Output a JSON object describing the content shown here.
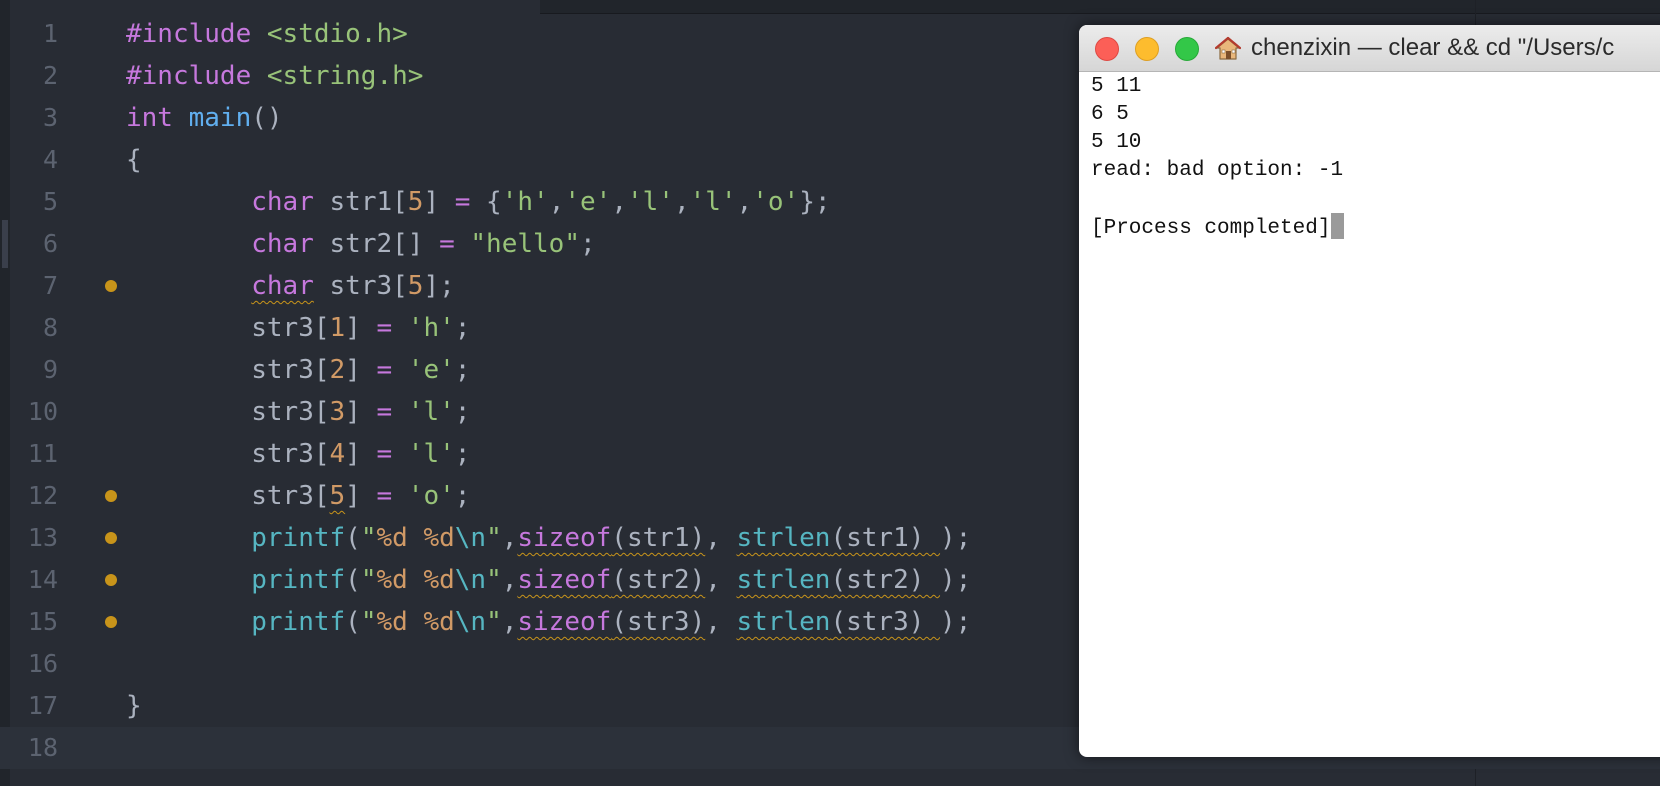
{
  "editor": {
    "lines": [
      {
        "n": "1",
        "dot": false,
        "cursor": false,
        "tokens": [
          {
            "t": "#include ",
            "c": "kw"
          },
          {
            "t": "<stdio.h>",
            "c": "str"
          }
        ]
      },
      {
        "n": "2",
        "dot": false,
        "cursor": false,
        "tokens": [
          {
            "t": "#include ",
            "c": "kw"
          },
          {
            "t": "<string.h>",
            "c": "str"
          }
        ]
      },
      {
        "n": "3",
        "dot": false,
        "cursor": false,
        "tokens": [
          {
            "t": "int ",
            "c": "kw"
          },
          {
            "t": "main",
            "c": "fn"
          },
          {
            "t": "()",
            "c": "punc"
          }
        ]
      },
      {
        "n": "4",
        "dot": false,
        "cursor": false,
        "tokens": [
          {
            "t": "{",
            "c": "punc"
          }
        ]
      },
      {
        "n": "5",
        "dot": false,
        "cursor": false,
        "tokens": [
          {
            "t": "        ",
            "c": "plain"
          },
          {
            "t": "char",
            "c": "kw"
          },
          {
            "t": " str1[",
            "c": "plain"
          },
          {
            "t": "5",
            "c": "num"
          },
          {
            "t": "] ",
            "c": "plain"
          },
          {
            "t": "=",
            "c": "op"
          },
          {
            "t": " {",
            "c": "plain"
          },
          {
            "t": "'h'",
            "c": "str"
          },
          {
            "t": ",",
            "c": "plain"
          },
          {
            "t": "'e'",
            "c": "str"
          },
          {
            "t": ",",
            "c": "plain"
          },
          {
            "t": "'l'",
            "c": "str"
          },
          {
            "t": ",",
            "c": "plain"
          },
          {
            "t": "'l'",
            "c": "str"
          },
          {
            "t": ",",
            "c": "plain"
          },
          {
            "t": "'o'",
            "c": "str"
          },
          {
            "t": "};",
            "c": "plain"
          }
        ]
      },
      {
        "n": "6",
        "dot": false,
        "cursor": false,
        "tokens": [
          {
            "t": "        ",
            "c": "plain"
          },
          {
            "t": "char",
            "c": "kw"
          },
          {
            "t": " str2[] ",
            "c": "plain"
          },
          {
            "t": "=",
            "c": "op"
          },
          {
            "t": " ",
            "c": "plain"
          },
          {
            "t": "\"hello\"",
            "c": "str"
          },
          {
            "t": ";",
            "c": "plain"
          }
        ]
      },
      {
        "n": "7",
        "dot": true,
        "cursor": false,
        "tokens": [
          {
            "t": "        ",
            "c": "plain"
          },
          {
            "t": "char",
            "c": "kw",
            "w": true
          },
          {
            "t": " str3[",
            "c": "plain"
          },
          {
            "t": "5",
            "c": "num"
          },
          {
            "t": "];",
            "c": "plain"
          }
        ]
      },
      {
        "n": "8",
        "dot": false,
        "cursor": false,
        "tokens": [
          {
            "t": "        ",
            "c": "plain"
          },
          {
            "t": "str3[",
            "c": "plain"
          },
          {
            "t": "1",
            "c": "num"
          },
          {
            "t": "] ",
            "c": "plain"
          },
          {
            "t": "=",
            "c": "op"
          },
          {
            "t": " ",
            "c": "plain"
          },
          {
            "t": "'h'",
            "c": "str"
          },
          {
            "t": ";",
            "c": "plain"
          }
        ]
      },
      {
        "n": "9",
        "dot": false,
        "cursor": false,
        "tokens": [
          {
            "t": "        ",
            "c": "plain"
          },
          {
            "t": "str3[",
            "c": "plain"
          },
          {
            "t": "2",
            "c": "num"
          },
          {
            "t": "] ",
            "c": "plain"
          },
          {
            "t": "=",
            "c": "op"
          },
          {
            "t": " ",
            "c": "plain"
          },
          {
            "t": "'e'",
            "c": "str"
          },
          {
            "t": ";",
            "c": "plain"
          }
        ]
      },
      {
        "n": "10",
        "dot": false,
        "cursor": false,
        "tokens": [
          {
            "t": "        ",
            "c": "plain"
          },
          {
            "t": "str3[",
            "c": "plain"
          },
          {
            "t": "3",
            "c": "num"
          },
          {
            "t": "] ",
            "c": "plain"
          },
          {
            "t": "=",
            "c": "op"
          },
          {
            "t": " ",
            "c": "plain"
          },
          {
            "t": "'l'",
            "c": "str"
          },
          {
            "t": ";",
            "c": "plain"
          }
        ]
      },
      {
        "n": "11",
        "dot": false,
        "cursor": false,
        "tokens": [
          {
            "t": "        ",
            "c": "plain"
          },
          {
            "t": "str3[",
            "c": "plain"
          },
          {
            "t": "4",
            "c": "num"
          },
          {
            "t": "] ",
            "c": "plain"
          },
          {
            "t": "=",
            "c": "op"
          },
          {
            "t": " ",
            "c": "plain"
          },
          {
            "t": "'l'",
            "c": "str"
          },
          {
            "t": ";",
            "c": "plain"
          }
        ]
      },
      {
        "n": "12",
        "dot": true,
        "cursor": false,
        "tokens": [
          {
            "t": "        ",
            "c": "plain"
          },
          {
            "t": "str3[",
            "c": "plain"
          },
          {
            "t": "5",
            "c": "num",
            "w": true
          },
          {
            "t": "] ",
            "c": "plain"
          },
          {
            "t": "=",
            "c": "op"
          },
          {
            "t": " ",
            "c": "plain"
          },
          {
            "t": "'o'",
            "c": "str"
          },
          {
            "t": ";",
            "c": "plain"
          }
        ]
      },
      {
        "n": "13",
        "dot": true,
        "cursor": false,
        "tokens": [
          {
            "t": "        ",
            "c": "plain"
          },
          {
            "t": "printf",
            "c": "fn2"
          },
          {
            "t": "(",
            "c": "plain"
          },
          {
            "t": "\"",
            "c": "str"
          },
          {
            "t": "%d",
            "c": "fmt"
          },
          {
            "t": " ",
            "c": "str"
          },
          {
            "t": "%d",
            "c": "fmt"
          },
          {
            "t": "\\n",
            "c": "esc"
          },
          {
            "t": "\"",
            "c": "str"
          },
          {
            "t": ",",
            "c": "plain"
          },
          {
            "t": "sizeof",
            "c": "kw",
            "w": true
          },
          {
            "t": "(str1)",
            "c": "plain",
            "w": true
          },
          {
            "t": ", ",
            "c": "plain"
          },
          {
            "t": "strlen",
            "c": "fn2",
            "w": true
          },
          {
            "t": "(str1) ",
            "c": "plain",
            "w": true
          },
          {
            "t": ");",
            "c": "plain"
          }
        ]
      },
      {
        "n": "14",
        "dot": true,
        "cursor": false,
        "tokens": [
          {
            "t": "        ",
            "c": "plain"
          },
          {
            "t": "printf",
            "c": "fn2"
          },
          {
            "t": "(",
            "c": "plain"
          },
          {
            "t": "\"",
            "c": "str"
          },
          {
            "t": "%d",
            "c": "fmt"
          },
          {
            "t": " ",
            "c": "str"
          },
          {
            "t": "%d",
            "c": "fmt"
          },
          {
            "t": "\\n",
            "c": "esc"
          },
          {
            "t": "\"",
            "c": "str"
          },
          {
            "t": ",",
            "c": "plain"
          },
          {
            "t": "sizeof",
            "c": "kw",
            "w": true
          },
          {
            "t": "(str2)",
            "c": "plain",
            "w": true
          },
          {
            "t": ", ",
            "c": "plain"
          },
          {
            "t": "strlen",
            "c": "fn2",
            "w": true
          },
          {
            "t": "(str2) ",
            "c": "plain",
            "w": true
          },
          {
            "t": ");",
            "c": "plain"
          }
        ]
      },
      {
        "n": "15",
        "dot": true,
        "cursor": false,
        "tokens": [
          {
            "t": "        ",
            "c": "plain"
          },
          {
            "t": "printf",
            "c": "fn2"
          },
          {
            "t": "(",
            "c": "plain"
          },
          {
            "t": "\"",
            "c": "str"
          },
          {
            "t": "%d",
            "c": "fmt"
          },
          {
            "t": " ",
            "c": "str"
          },
          {
            "t": "%d",
            "c": "fmt"
          },
          {
            "t": "\\n",
            "c": "esc"
          },
          {
            "t": "\"",
            "c": "str"
          },
          {
            "t": ",",
            "c": "plain"
          },
          {
            "t": "sizeof",
            "c": "kw",
            "w": true
          },
          {
            "t": "(str3)",
            "c": "plain",
            "w": true
          },
          {
            "t": ", ",
            "c": "plain"
          },
          {
            "t": "strlen",
            "c": "fn2",
            "w": true
          },
          {
            "t": "(str3) ",
            "c": "plain",
            "w": true
          },
          {
            "t": ");",
            "c": "plain"
          }
        ]
      },
      {
        "n": "16",
        "dot": false,
        "cursor": false,
        "tokens": []
      },
      {
        "n": "17",
        "dot": false,
        "cursor": false,
        "tokens": [
          {
            "t": "}",
            "c": "punc"
          }
        ]
      },
      {
        "n": "18",
        "dot": false,
        "cursor": true,
        "tokens": []
      }
    ]
  },
  "terminal": {
    "title": "chenzixin — clear && cd \"/Users/c",
    "home_icon": "home-icon",
    "output": [
      "5 11",
      "6 5",
      "5 10",
      "read: bad option: -1",
      "",
      "[Process completed]"
    ],
    "colors": {
      "close": "#fc5f57",
      "minimize": "#fdbc2e",
      "maximize": "#33c748"
    }
  },
  "theme": {
    "editor_bg": "#282c34",
    "warning_dot": "#c8941a"
  }
}
